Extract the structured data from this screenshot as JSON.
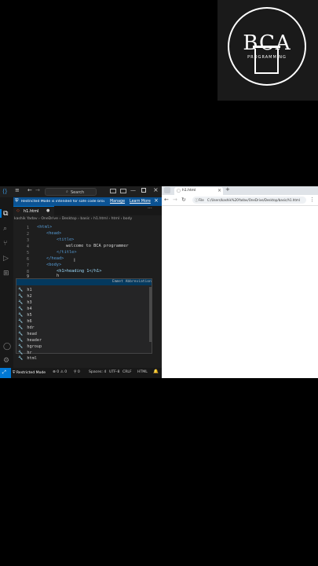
{
  "logo": {
    "main": "BCA",
    "sub": "PROGRAMMING"
  },
  "vscode": {
    "search_label": "Search",
    "notification": {
      "text": "Restricted Mode is intended for safe code browsing. Tr...",
      "manage": "Manage",
      "learn_more": "Learn More"
    },
    "tab": {
      "label": "h1.html",
      "dirty_marker": "●"
    },
    "breadcrumb": [
      "kashik Yadav",
      "OneDrive",
      "Desktop",
      "basic",
      "h1.html",
      "html",
      "body"
    ],
    "lines": [
      {
        "num": "1",
        "indent": "",
        "text": "<html>"
      },
      {
        "num": "2",
        "indent": "    ",
        "text": "<head>"
      },
      {
        "num": "3",
        "indent": "        ",
        "text": "<title>"
      },
      {
        "num": "4",
        "indent": "            ",
        "text": "welcome to BCA programmer"
      },
      {
        "num": "5",
        "indent": "        ",
        "text": "</title>"
      },
      {
        "num": "6",
        "indent": "    ",
        "text": "</head>"
      },
      {
        "num": "7",
        "indent": "    ",
        "text": "<body>"
      },
      {
        "num": "8",
        "indent": "        ",
        "text": "<h1>heading 1</h1>"
      },
      {
        "num": "9",
        "indent": "        ",
        "text": "h"
      }
    ],
    "suggestions": [
      "h1",
      "h2",
      "h3",
      "h4",
      "h5",
      "h6",
      "hdr",
      "head",
      "header",
      "hgroup",
      "hr",
      "html"
    ],
    "suggestion_detail": "Emmet Abbreviation",
    "status": {
      "restricted": "Restricted Mode",
      "problems": "⊗ 0 ⚠ 0",
      "ports": "⚲ 0",
      "spaces": "Spaces: 4",
      "encoding": "UTF-8",
      "eol": "CRLF",
      "language": "HTML"
    }
  },
  "browser": {
    "tab_title": "h1.html",
    "new_tab": "+",
    "address_prefix": "File",
    "address": "C:/Users/kashik%20Yadav/OneDrive/Desktop/basic/h1.html"
  }
}
